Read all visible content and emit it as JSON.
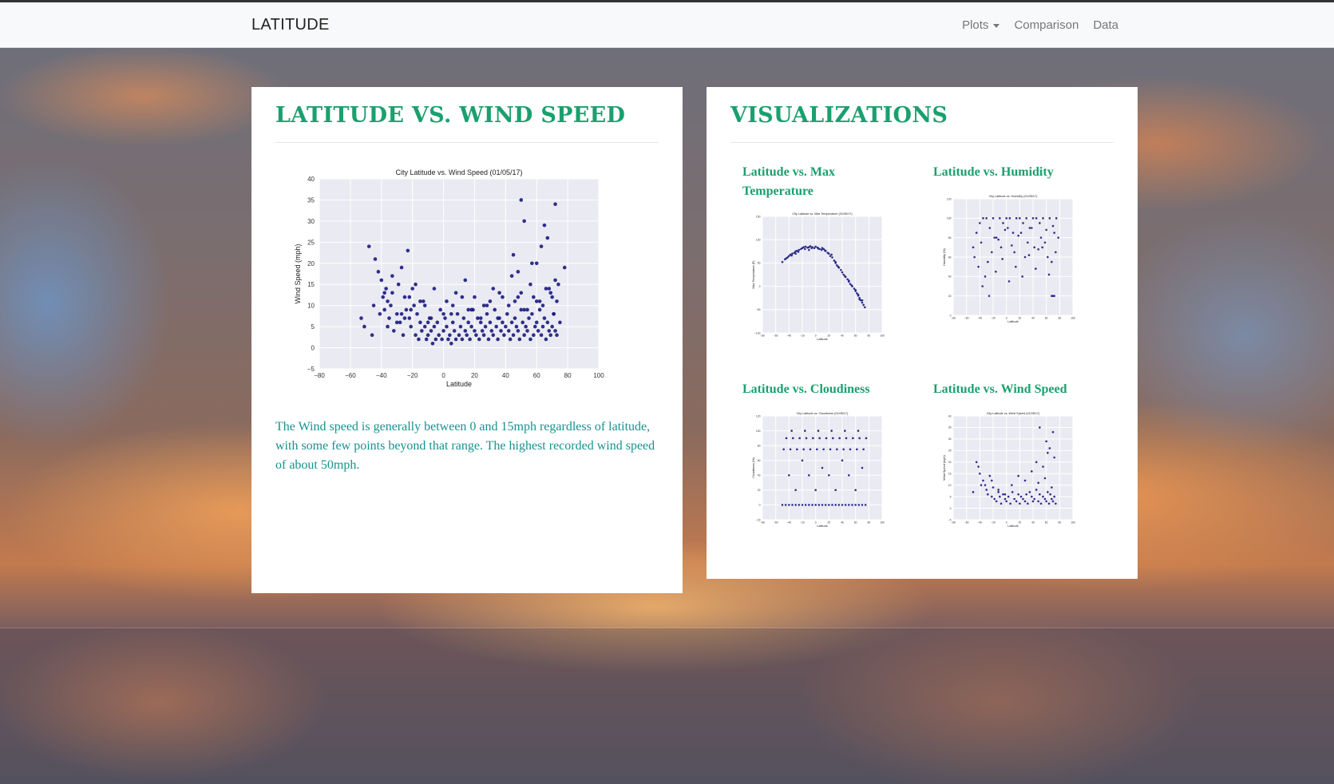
{
  "navbar": {
    "brand": "LATITUDE",
    "links": [
      "Plots",
      "Comparison",
      "Data"
    ]
  },
  "main": {
    "heading": "LATITUDE VS. WIND SPEED",
    "description": "The Wind speed is generally between 0 and 15mph regardless of latitude, with some few points beyond that range. The highest recorded wind speed of about 50mph."
  },
  "sidebar": {
    "heading": "VISUALIZATIONS",
    "items": [
      {
        "title": "Latitude vs. Max Temperature"
      },
      {
        "title": "Latitude vs. Humidity"
      },
      {
        "title": "Latitude vs. Cloudiness"
      },
      {
        "title": "Latitude vs. Wind Speed"
      }
    ]
  },
  "colors": {
    "accent": "#1aa06e",
    "text_teal": "#17928f",
    "marker": "#1a1a7e",
    "plot_bg": "#eaeaf2"
  },
  "chart_data": [
    {
      "type": "scatter",
      "title": "City Latitude vs. Wind Speed (01/05/17)",
      "xlabel": "Latitude",
      "ylabel": "Wind Speed (mph)",
      "xlim": [
        -80,
        100
      ],
      "ylim": [
        -5,
        40
      ],
      "xticks": [
        -80,
        -60,
        -40,
        -20,
        0,
        20,
        40,
        60,
        80,
        100
      ],
      "yticks": [
        -5,
        0,
        5,
        10,
        15,
        20,
        25,
        30,
        35,
        40
      ],
      "x": [
        -53,
        -51,
        -48,
        -46,
        -44,
        -42,
        -40,
        -39,
        -38,
        -37,
        -36,
        -35,
        -34,
        -33,
        -32,
        -30,
        -29,
        -28,
        -27,
        -26,
        -25,
        -24,
        -23,
        -22,
        -21,
        -20,
        -19,
        -18,
        -17,
        -16,
        -15,
        -14,
        -13,
        -12,
        -11,
        -10,
        -9,
        -8,
        -7,
        -6,
        -5,
        -4,
        -3,
        -2,
        -1,
        0,
        1,
        2,
        3,
        4,
        5,
        6,
        7,
        8,
        9,
        10,
        11,
        12,
        13,
        14,
        15,
        16,
        17,
        18,
        19,
        20,
        21,
        22,
        23,
        24,
        25,
        26,
        27,
        28,
        29,
        30,
        31,
        32,
        33,
        34,
        35,
        36,
        37,
        38,
        39,
        40,
        41,
        42,
        43,
        44,
        45,
        46,
        47,
        48,
        49,
        50,
        51,
        52,
        53,
        54,
        55,
        56,
        57,
        58,
        59,
        60,
        61,
        62,
        63,
        64,
        65,
        66,
        67,
        68,
        69,
        70,
        71,
        72,
        73,
        75,
        78,
        -45,
        -38,
        -33,
        -27,
        -22,
        -18,
        -12,
        -6,
        2,
        8,
        14,
        20,
        26,
        32,
        38,
        44,
        50,
        56,
        62,
        68,
        72,
        -41,
        -30,
        -21,
        -15,
        -8,
        0,
        6,
        12,
        18,
        24,
        30,
        36,
        42,
        48,
        54,
        60,
        66,
        70,
        74,
        -36,
        -25,
        -10,
        5,
        16,
        28,
        35,
        46,
        52,
        58,
        64,
        69,
        71,
        73,
        50,
        52,
        65,
        67,
        72,
        45,
        48,
        57,
        63,
        60
      ],
      "y": [
        7,
        5,
        24,
        3,
        21,
        18,
        16,
        12,
        9,
        14,
        11,
        7,
        10,
        13,
        4,
        8,
        15,
        6,
        19,
        3,
        12,
        9,
        23,
        7,
        5,
        14,
        10,
        3,
        8,
        2,
        6,
        4,
        11,
        5,
        2,
        3,
        7,
        4,
        1,
        5,
        2,
        6,
        3,
        9,
        2,
        4,
        7,
        5,
        2,
        3,
        1,
        6,
        4,
        2,
        8,
        3,
        5,
        2,
        7,
        4,
        3,
        6,
        2,
        5,
        9,
        4,
        3,
        7,
        2,
        6,
        4,
        3,
        5,
        8,
        2,
        6,
        4,
        3,
        9,
        5,
        2,
        7,
        4,
        6,
        3,
        5,
        8,
        4,
        2,
        6,
        3,
        7,
        5,
        4,
        2,
        9,
        6,
        3,
        5,
        4,
        7,
        2,
        8,
        3,
        5,
        6,
        4,
        9,
        3,
        5,
        7,
        2,
        6,
        4,
        3,
        5,
        8,
        4,
        3,
        6,
        19,
        10,
        13,
        17,
        8,
        12,
        15,
        10,
        14,
        11,
        13,
        16,
        12,
        10,
        14,
        12,
        17,
        13,
        15,
        11,
        14,
        16,
        8,
        6,
        9,
        11,
        7,
        8,
        10,
        12,
        9,
        7,
        11,
        13,
        10,
        12,
        9,
        11,
        14,
        12,
        15,
        5,
        7,
        6,
        8,
        9,
        10,
        7,
        11,
        9,
        12,
        10,
        13,
        8,
        11,
        35,
        30,
        29,
        26,
        34,
        22,
        18,
        20,
        24,
        20
      ]
    },
    {
      "type": "scatter",
      "title": "City Latitude vs. Max Temperature (01/05/17)",
      "xlabel": "Latitude",
      "ylabel": "Max Temperature (F)",
      "xlim": [
        -80,
        100
      ],
      "ylim": [
        -100,
        150
      ],
      "x": [
        -50,
        -46,
        -42,
        -40,
        -38,
        -35,
        -32,
        -30,
        -28,
        -25,
        -22,
        -20,
        -18,
        -15,
        -12,
        -10,
        -8,
        -5,
        -2,
        0,
        3,
        6,
        9,
        12,
        15,
        18,
        20,
        22,
        25,
        28,
        30,
        32,
        35,
        38,
        40,
        42,
        45,
        48,
        50,
        52,
        55,
        58,
        60,
        62,
        64,
        66,
        68,
        70,
        72,
        74,
        -44,
        -36,
        -26,
        -16,
        -6,
        4,
        14,
        24,
        34,
        44,
        54,
        64,
        70,
        -30,
        -10,
        10,
        30,
        50,
        60,
        66
      ],
      "y": [
        52,
        58,
        62,
        65,
        68,
        70,
        72,
        75,
        76,
        78,
        80,
        82,
        84,
        85,
        83,
        84,
        86,
        84,
        82,
        85,
        83,
        80,
        78,
        80,
        76,
        72,
        70,
        65,
        62,
        55,
        50,
        45,
        40,
        35,
        30,
        25,
        20,
        15,
        10,
        5,
        0,
        -5,
        -10,
        -15,
        -20,
        -25,
        -30,
        -35,
        -40,
        -45,
        60,
        66,
        74,
        80,
        82,
        81,
        77,
        68,
        42,
        22,
        2,
        -18,
        -30,
        70,
        78,
        82,
        52,
        12,
        -8,
        -28
      ]
    },
    {
      "type": "scatter",
      "title": "City Latitude vs. Humidity (01/05/17)",
      "xlabel": "Latitude",
      "ylabel": "Humidity (%)",
      "xlim": [
        -80,
        100
      ],
      "ylim": [
        0,
        120
      ],
      "x": [
        -50,
        -45,
        -40,
        -35,
        -30,
        -25,
        -20,
        -15,
        -10,
        -5,
        0,
        5,
        10,
        15,
        20,
        25,
        30,
        35,
        40,
        45,
        50,
        55,
        60,
        65,
        70,
        75,
        -48,
        -38,
        -28,
        -18,
        -8,
        2,
        12,
        22,
        32,
        42,
        52,
        62,
        72,
        -42,
        -32,
        -22,
        -12,
        -2,
        8,
        18,
        28,
        38,
        48,
        58,
        68,
        78,
        -36,
        -26,
        -16,
        -6,
        4,
        14,
        24,
        34,
        44,
        54,
        64,
        74,
        68,
        70,
        72
      ],
      "y": [
        70,
        85,
        95,
        100,
        100,
        90,
        100,
        80,
        100,
        95,
        100,
        100,
        85,
        100,
        100,
        95,
        100,
        90,
        100,
        100,
        95,
        100,
        88,
        100,
        92,
        100,
        60,
        75,
        55,
        80,
        70,
        90,
        65,
        85,
        75,
        70,
        80,
        60,
        85,
        50,
        40,
        65,
        78,
        88,
        72,
        82,
        60,
        90,
        68,
        75,
        55,
        80,
        30,
        20,
        45,
        58,
        35,
        50,
        40,
        62,
        48,
        70,
        42,
        65,
        20,
        20,
        20
      ]
    },
    {
      "type": "scatter",
      "title": "City Latitude vs. Cloudiness (01/05/17)",
      "xlabel": "Latitude",
      "ylabel": "Cloudiness (%)",
      "xlim": [
        -80,
        100
      ],
      "ylim": [
        -20,
        120
      ],
      "x": [
        -50,
        -45,
        -40,
        -35,
        -30,
        -25,
        -20,
        -15,
        -10,
        -5,
        0,
        5,
        10,
        15,
        20,
        25,
        30,
        35,
        40,
        45,
        50,
        55,
        60,
        65,
        70,
        75,
        -48,
        -38,
        -28,
        -18,
        -8,
        2,
        12,
        22,
        32,
        42,
        52,
        62,
        72,
        -44,
        -34,
        -24,
        -14,
        -4,
        6,
        16,
        26,
        36,
        46,
        56,
        66,
        76,
        -40,
        -30,
        -20,
        -10,
        0,
        10,
        20,
        30,
        40,
        50,
        60,
        70,
        -36,
        -16,
        4,
        24,
        44,
        64
      ],
      "y": [
        0,
        0,
        0,
        0,
        0,
        0,
        0,
        0,
        0,
        0,
        0,
        0,
        0,
        0,
        0,
        0,
        0,
        0,
        0,
        0,
        0,
        0,
        0,
        0,
        0,
        0,
        75,
        75,
        75,
        75,
        75,
        75,
        75,
        75,
        75,
        75,
        75,
        75,
        75,
        90,
        90,
        90,
        90,
        90,
        90,
        90,
        90,
        90,
        90,
        90,
        90,
        90,
        40,
        20,
        60,
        40,
        20,
        50,
        40,
        20,
        60,
        40,
        20,
        50,
        100,
        100,
        100,
        100,
        100,
        100
      ]
    },
    {
      "type": "scatter",
      "title": "City Latitude vs. Wind Speed (01/05/17)",
      "xlabel": "Latitude",
      "ylabel": "Wind Speed (mph)",
      "xlim": [
        -80,
        100
      ],
      "ylim": [
        -5,
        40
      ],
      "x": [
        -50,
        -45,
        -40,
        -38,
        -35,
        -30,
        -28,
        -25,
        -22,
        -20,
        -18,
        -15,
        -12,
        -10,
        -8,
        -5,
        -2,
        0,
        3,
        6,
        9,
        12,
        15,
        18,
        20,
        22,
        25,
        28,
        30,
        32,
        35,
        38,
        40,
        42,
        45,
        48,
        50,
        52,
        55,
        58,
        60,
        62,
        64,
        66,
        68,
        70,
        72,
        74,
        -42,
        -32,
        -22,
        -12,
        -2,
        8,
        18,
        28,
        38,
        48,
        58,
        68,
        50,
        60,
        65,
        70,
        72,
        45,
        55,
        62
      ],
      "y": [
        7,
        20,
        15,
        10,
        12,
        8,
        6,
        14,
        5,
        9,
        4,
        3,
        7,
        5,
        2,
        6,
        4,
        3,
        5,
        2,
        7,
        4,
        3,
        6,
        2,
        5,
        4,
        3,
        6,
        2,
        7,
        5,
        3,
        4,
        8,
        3,
        6,
        2,
        5,
        4,
        3,
        7,
        2,
        6,
        4,
        3,
        5,
        2,
        18,
        10,
        12,
        8,
        6,
        10,
        14,
        12,
        16,
        11,
        13,
        9,
        35,
        29,
        26,
        33,
        22,
        20,
        18,
        24
      ]
    }
  ]
}
